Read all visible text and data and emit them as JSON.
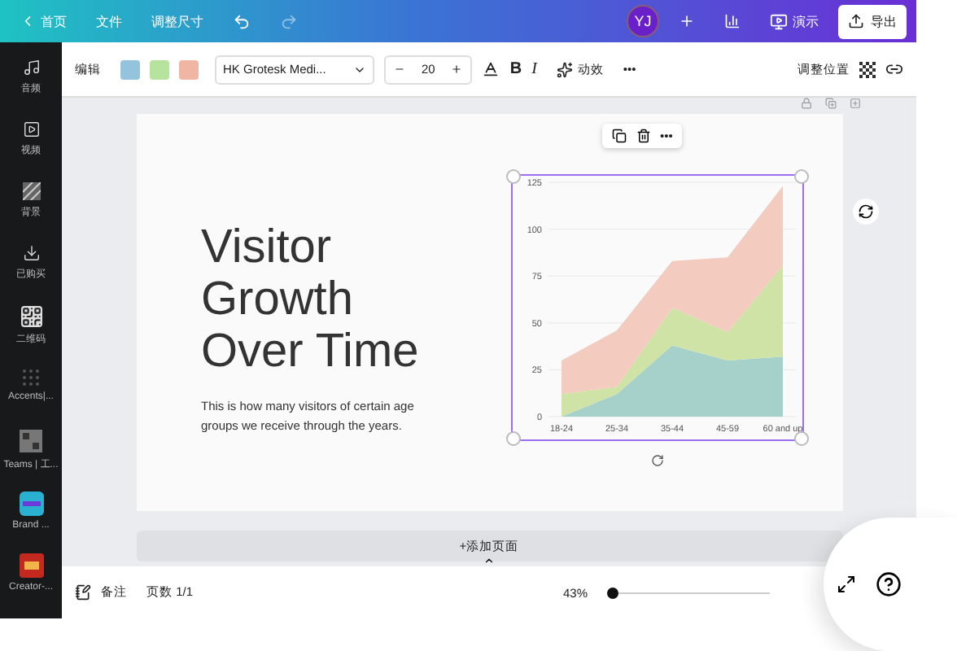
{
  "topbar": {
    "home": "首页",
    "menu": [
      "文件",
      "调整尺寸"
    ],
    "undo_disabled": false,
    "redo_disabled": true,
    "avatar": "YJ",
    "present": "演示",
    "export": "导出"
  },
  "toolbar": {
    "edit": "编辑",
    "swatches": [
      {
        "color": "#93c3dd"
      },
      {
        "color": "#b6e49e"
      },
      {
        "color": "#f0b6a3"
      }
    ],
    "font": "HK Grotesk Medi...",
    "size": "20",
    "bold": "B",
    "italic": "I",
    "effects": "动效",
    "more": "•••",
    "position": "调整位置"
  },
  "sidebar": {
    "items": [
      {
        "label": "音频",
        "kind": "music"
      },
      {
        "label": "视频",
        "kind": "video"
      },
      {
        "label": "背景",
        "kind": "pattern"
      },
      {
        "label": "已购买",
        "kind": "download"
      },
      {
        "label": "二维码",
        "kind": "qr"
      },
      {
        "label": "Accents|...",
        "kind": "dots"
      },
      {
        "label": "Teams | 工...",
        "kind": "grid"
      },
      {
        "label": "Brand ...",
        "kind": "app"
      },
      {
        "label": "Creator-...",
        "kind": "app2"
      }
    ]
  },
  "element_menu": {
    "more": "•••"
  },
  "slide": {
    "title": "Visitor Growth Over Time",
    "body": "This is how many visitors of certain age groups we receive through the years.",
    "chart_data": {
      "type": "area",
      "stacked": true,
      "grid": true,
      "categories": [
        "18-24",
        "25-34",
        "35-44",
        "45-59",
        "60 and up"
      ],
      "ylim": [
        0,
        125
      ],
      "yticks": [
        0,
        25,
        50,
        75,
        100,
        125
      ],
      "series": [
        {
          "color": "#a6d1cb",
          "values": [
            0,
            12,
            38,
            30,
            32
          ]
        },
        {
          "color": "#cfe3a6",
          "values": [
            12,
            4,
            20,
            15,
            49
          ]
        },
        {
          "color": "#f3cbbf",
          "values": [
            18,
            30,
            25,
            40,
            42
          ]
        }
      ]
    }
  },
  "add_page": "+添加页面",
  "bottombar": {
    "notes": "备注",
    "pages": "页数 1/1",
    "zoom": "43%",
    "zoom_level": {
      "level": 0.03
    }
  }
}
